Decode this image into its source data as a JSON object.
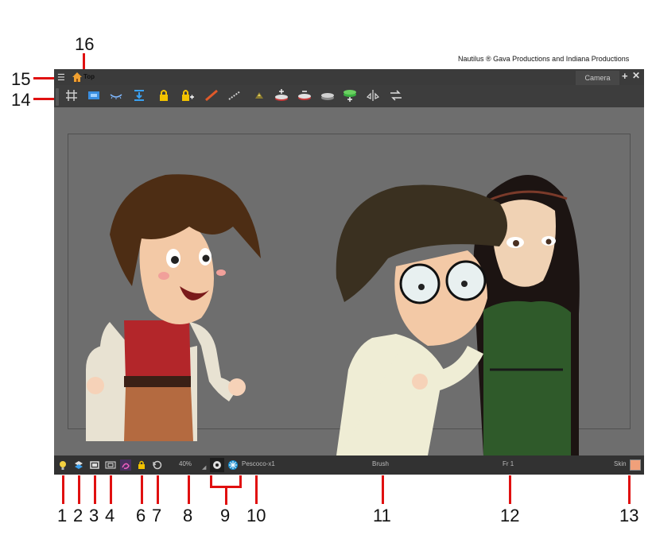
{
  "credit": "Nautilus ® Gava Productions and Indiana Productions",
  "titlebar": {
    "view_title": "Top",
    "tab_label": "Camera"
  },
  "toolbar": {
    "icons": [
      "grid-icon",
      "onion-skin-icon",
      "light-table-icon",
      "show-current-drawing-icon",
      "lock-icon",
      "add-lock-icon",
      "bone-icon",
      "pencil-line-icon",
      "background-icon",
      "layer-above-icon",
      "layer-below-icon",
      "layer-flatten-icon",
      "layer-add-icon",
      "mirror-icon",
      "flip-icon"
    ]
  },
  "statusbar": {
    "zoom": "40%",
    "drawing_name": "Pescoco-x1",
    "tool": "Brush",
    "frame": "Fr 1",
    "skin_label": "Skin",
    "skin_color": "#f0a07a"
  },
  "callouts": [
    "1",
    "2",
    "3",
    "4",
    "6",
    "7",
    "8",
    "9",
    "10",
    "11",
    "12",
    "13",
    "14",
    "15",
    "16"
  ],
  "colors": {
    "callout_line": "#e01010",
    "window_bg": "#3a3a3a",
    "viewport_bg": "#6e6e6e"
  }
}
